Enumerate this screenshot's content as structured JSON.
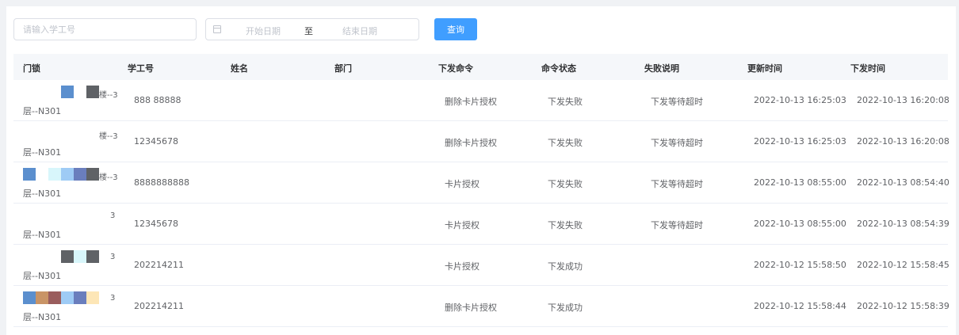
{
  "search": {
    "student_id_placeholder": "请输入学工号"
  },
  "date_range": {
    "start_placeholder": "开始日期",
    "separator": "至",
    "end_placeholder": "结束日期"
  },
  "query_button": "查询",
  "columns": [
    "门锁",
    "学工号",
    "姓名",
    "部门",
    "下发命令",
    "命令状态",
    "失败说明",
    "更新时间",
    "下发时间"
  ],
  "rows": [
    {
      "lock_line1": "…楼--3",
      "lock_line2": "层--N301",
      "student_id": "888 88888",
      "name": "",
      "department": "",
      "command": "删除卡片授权",
      "status": "下发失败",
      "reason": "下发等待超时",
      "updated": "2022-10-13 16:25:03",
      "issued": "2022-10-13 16:20:08"
    },
    {
      "lock_line1": "…楼--3",
      "lock_line2": "层--N301",
      "student_id": "12345678",
      "name": "",
      "department": "",
      "command": "删除卡片授权",
      "status": "下发失败",
      "reason": "下发等待超时",
      "updated": "2022-10-13 16:25:03",
      "issued": "2022-10-13 16:20:08"
    },
    {
      "lock_line1": "…楼--3",
      "lock_line2": "层--N301",
      "student_id": "8888888888",
      "name": "",
      "department": "",
      "command": "卡片授权",
      "status": "下发失败",
      "reason": "下发等待超时",
      "updated": "2022-10-13 08:55:00",
      "issued": "2022-10-13 08:54:40"
    },
    {
      "lock_line1": "3",
      "lock_line2": "层--N301",
      "student_id": "12345678",
      "name": "",
      "department": "",
      "command": "卡片授权",
      "status": "下发失败",
      "reason": "下发等待超时",
      "updated": "2022-10-13 08:55:00",
      "issued": "2022-10-13 08:54:39"
    },
    {
      "lock_line1": "3",
      "lock_line2": "层--N301",
      "student_id": "202214211",
      "name": "",
      "department": "",
      "command": "卡片授权",
      "status": "下发成功",
      "reason": "",
      "updated": "2022-10-12 15:58:50",
      "issued": "2022-10-12 15:58:45"
    },
    {
      "lock_line1": "3",
      "lock_line2": "层--N301",
      "student_id": "202214211",
      "name": "",
      "department": "",
      "command": "删除卡片授权",
      "status": "下发成功",
      "reason": "",
      "updated": "2022-10-12 15:58:44",
      "issued": "2022-10-12 15:58:39"
    }
  ],
  "mosaics": [
    [
      "#ffffff",
      "#ffffff",
      "#ffffff",
      "#5b8fce",
      "#ffffff",
      "#5f6266"
    ],
    [
      "#ffffff",
      "#ffffff",
      "#ffffff",
      "#ffffff",
      "#ffffff",
      "#ffffff"
    ],
    [
      "#5b8fce",
      "#ffffff",
      "#d8f6fb",
      "#9ecbf5",
      "#6a7ebd",
      "#5f6266"
    ],
    [
      "#ffffff",
      "#ffffff",
      "#ffffff",
      "#ffffff",
      "#ffffff",
      "#ffffff"
    ],
    [
      "#ffffff",
      "#ffffff",
      "#ffffff",
      "#5f6266",
      "#d8f6fb",
      "#5f6266"
    ],
    [
      "#5b8fce",
      "#c99466",
      "#9a5d5d",
      "#9ecbf5",
      "#6a7ebd",
      "#fde6b6"
    ]
  ],
  "colors": {
    "primary": "#409eff",
    "header_bg": "#f5f7fa",
    "border": "#dcdfe6",
    "page_bg": "#f0f2f5"
  }
}
